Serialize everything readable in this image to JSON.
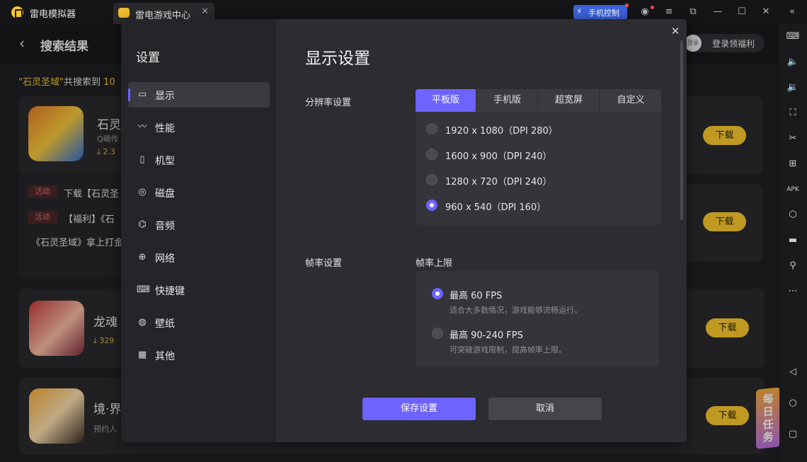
{
  "app": {
    "name": "雷电模拟器",
    "tab_title": "雷电游戏中心",
    "phone_control_label": "手机控制"
  },
  "window_buttons": [
    {
      "icon": "user-icon",
      "glyph": "◉"
    },
    {
      "icon": "pin-icon",
      "glyph": "⌂"
    },
    {
      "icon": "menu-icon",
      "glyph": "≡"
    },
    {
      "icon": "minimize-icon",
      "glyph": "—"
    },
    {
      "icon": "maximize-icon",
      "glyph": "☐"
    },
    {
      "icon": "close-icon",
      "glyph": "✕"
    },
    {
      "icon": "collapse-icon",
      "glyph": "«"
    }
  ],
  "page": {
    "title": "搜索结果",
    "login_avatar_text": "登录",
    "login_label": "登录领福利",
    "search_summary": {
      "quote_open": "\"",
      "keyword": "石灵圣域",
      "quote_close": "\"",
      "prefix": "共搜索到 ",
      "count": "10"
    }
  },
  "games": [
    {
      "title": "石灵",
      "subtitle": "Q萌传",
      "downloads": "2.3",
      "download_label": "下载",
      "activities": [
        {
          "tag": "活动",
          "text": "下载【石灵圣"
        },
        {
          "tag": "活动",
          "text": "【福利】《石"
        }
      ],
      "note": "《石灵圣域》拿上打金"
    },
    {
      "title": "龙魂",
      "downloads": "329",
      "download_label": "下载"
    },
    {
      "title": "境·界",
      "subtitle": "预约人",
      "download_label": "下载"
    }
  ],
  "hidden_card_download_label": "下载",
  "task_badge": "每日任务",
  "rail_icons": [
    "keyboard-icon",
    "volume-up-icon",
    "volume-down-icon",
    "fullscreen-icon",
    "scissors-icon",
    "add-window-icon",
    "apk-icon",
    "settings-hex-icon",
    "folder-icon",
    "location-icon",
    "more-icon",
    "back-icon",
    "home-icon",
    "recents-icon"
  ],
  "settings": {
    "sidebar_title": "设置",
    "nav": [
      {
        "label": "显示",
        "icon": "monitor-icon",
        "glyph": "▭",
        "active": true
      },
      {
        "label": "性能",
        "icon": "pulse-icon",
        "glyph": "〰",
        "active": false
      },
      {
        "label": "机型",
        "icon": "device-icon",
        "glyph": "▯",
        "active": false
      },
      {
        "label": "磁盘",
        "icon": "disk-icon",
        "glyph": "◎",
        "active": false
      },
      {
        "label": "音频",
        "icon": "gamepad-icon",
        "glyph": "⌬",
        "active": false
      },
      {
        "label": "网络",
        "icon": "globe-icon",
        "glyph": "⊕",
        "active": false
      },
      {
        "label": "快捷键",
        "icon": "keyboard-icon",
        "glyph": "⌨",
        "active": false
      },
      {
        "label": "壁纸",
        "icon": "palette-icon",
        "glyph": "◍",
        "active": false
      },
      {
        "label": "其他",
        "icon": "grid-icon",
        "glyph": "▦",
        "active": false
      }
    ],
    "title": "显示设置",
    "resolution": {
      "label": "分辨率设置",
      "tabs": [
        "平板版",
        "手机版",
        "超宽屏",
        "自定义"
      ],
      "active_tab": 0,
      "options": [
        {
          "label": "1920 x 1080（DPI 280）",
          "selected": false
        },
        {
          "label": "1600 x 900（DPI 240）",
          "selected": false
        },
        {
          "label": "1280 x 720（DPI 240）",
          "selected": false
        },
        {
          "label": "960 x 540（DPI 160）",
          "selected": true
        }
      ]
    },
    "framerate": {
      "label": "帧率设置",
      "sub_label": "帧率上限",
      "options": [
        {
          "label": "最高 60 FPS",
          "desc": "适合大多数情况，游戏能够流畅运行。",
          "selected": true
        },
        {
          "label": "最高 90-240 FPS",
          "desc": "可突破游戏限制，提高帧率上限。",
          "selected": false
        }
      ]
    },
    "save_label": "保存设置",
    "cancel_label": "取消"
  }
}
